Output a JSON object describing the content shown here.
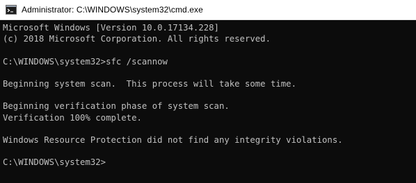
{
  "window": {
    "title": "Administrator: C:\\WINDOWS\\system32\\cmd.exe",
    "icon": "cmd-console-icon"
  },
  "console": {
    "lines": [
      "Microsoft Windows [Version 10.0.17134.228]",
      "(c) 2018 Microsoft Corporation. All rights reserved.",
      "",
      "C:\\WINDOWS\\system32>sfc /scannow",
      "",
      "Beginning system scan.  This process will take some time.",
      "",
      "Beginning verification phase of system scan.",
      "Verification 100% complete.",
      "",
      "Windows Resource Protection did not find any integrity violations.",
      "",
      "C:\\WINDOWS\\system32>"
    ]
  },
  "colors": {
    "console_background": "#0c0c0c",
    "console_text": "#c0c0c0",
    "titlebar_background": "#ffffff"
  }
}
